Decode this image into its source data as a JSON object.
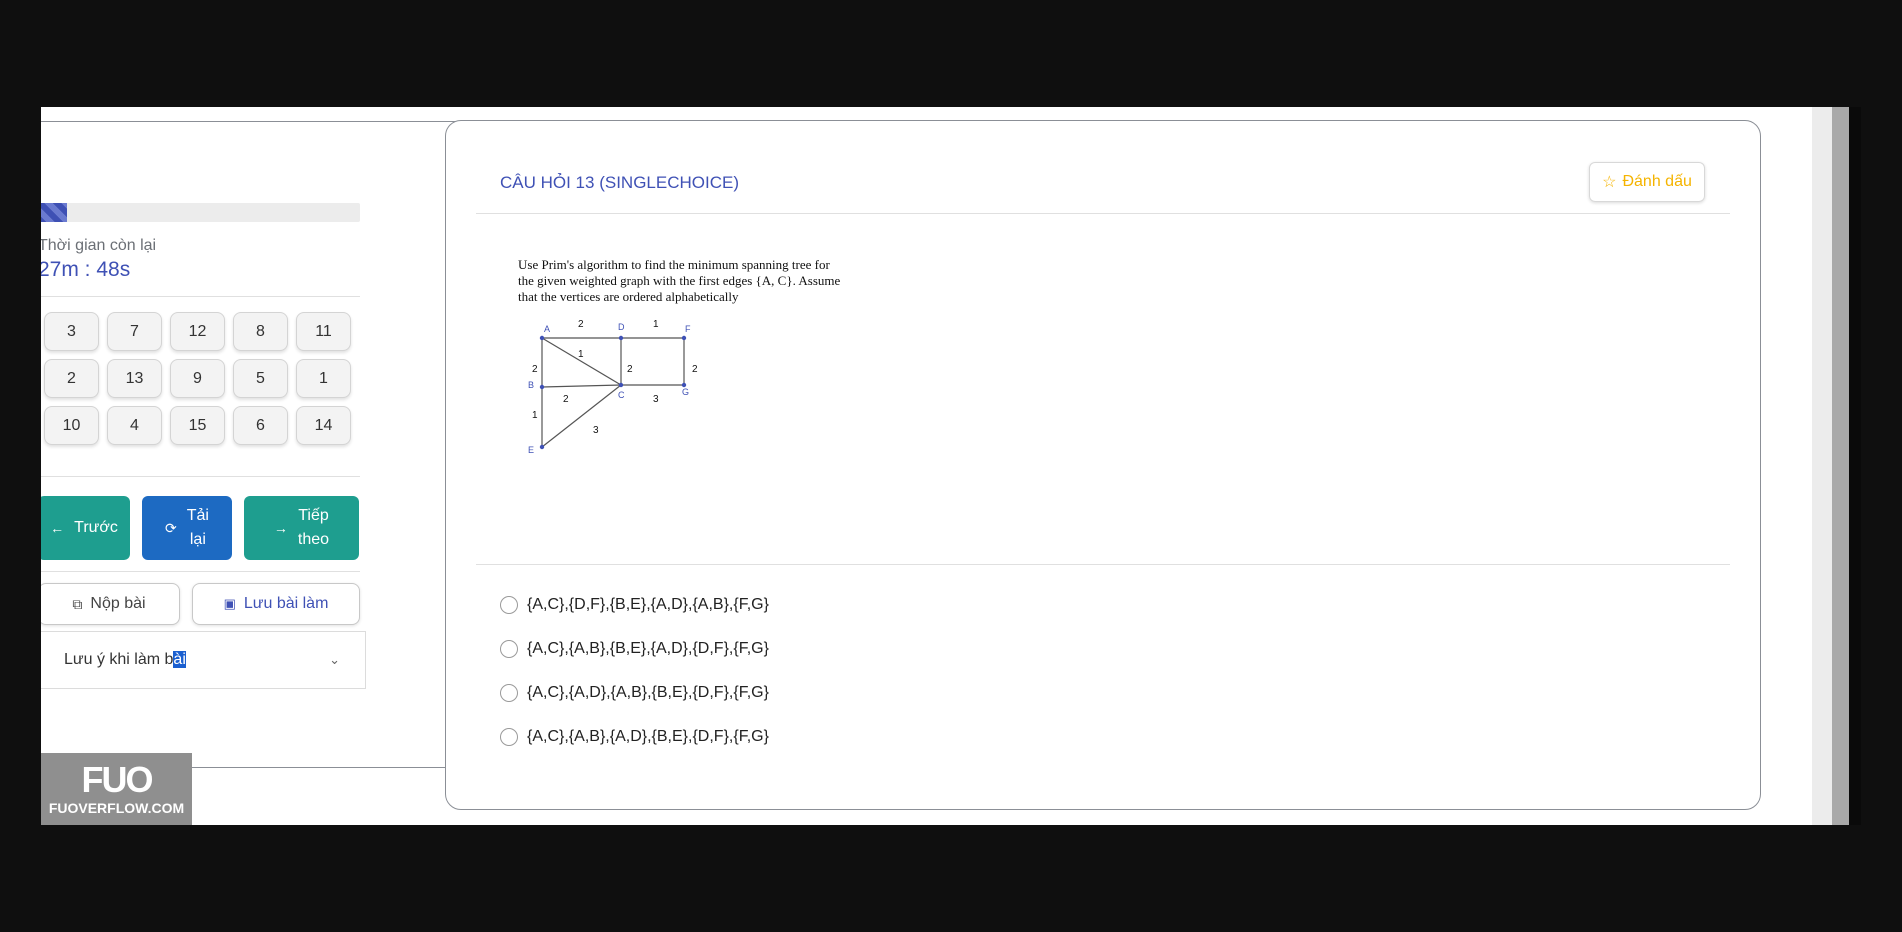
{
  "sidebar": {
    "progress_fraction": 0.09,
    "time_label": "Thời gian còn lại",
    "time_value": "27m : 48s",
    "question_numbers": [
      "3",
      "7",
      "12",
      "8",
      "11",
      "2",
      "13",
      "9",
      "5",
      "1",
      "10",
      "4",
      "15",
      "6",
      "14"
    ],
    "prev_label": "Trước",
    "reload_label_1": "Tải",
    "reload_label_2": "lại",
    "next_label_1": "Tiếp",
    "next_label_2": "theo",
    "submit_label": "Nộp bài",
    "save_label": "Lưu bài làm",
    "note_label_a": "Lưu ý khi làm b",
    "note_label_b": "ài",
    "logo_mark": "FUO",
    "logo_site": "FUOVERFLOW.COM"
  },
  "question": {
    "title": "CÂU HỎI 13 (SINGLECHOICE)",
    "mark_label": "Đánh dấu",
    "text_line1": "Use Prim's algorithm to find the minimum spanning tree for",
    "text_line2": "the given weighted graph with the first edges {A, C}. Assume",
    "text_line3": "that the vertices are ordered alphabetically",
    "graph": {
      "vertices": [
        "A",
        "B",
        "C",
        "D",
        "E",
        "F",
        "G"
      ],
      "edges": [
        {
          "from": "A",
          "to": "D",
          "w": "2"
        },
        {
          "from": "D",
          "to": "F",
          "w": "1"
        },
        {
          "from": "A",
          "to": "C",
          "w": "1"
        },
        {
          "from": "A",
          "to": "B",
          "w": "2"
        },
        {
          "from": "D",
          "to": "C",
          "w": "2"
        },
        {
          "from": "F",
          "to": "G",
          "w": "2"
        },
        {
          "from": "B",
          "to": "C",
          "w": "2"
        },
        {
          "from": "C",
          "to": "G",
          "w": "3"
        },
        {
          "from": "B",
          "to": "E",
          "w": "1"
        },
        {
          "from": "E",
          "to": "C",
          "w": "3"
        }
      ]
    },
    "options": [
      "{A,C},{D,F},{B,E},{A,D},{A,B},{F,G}",
      "{A,C},{A,B},{B,E},{A,D},{D,F},{F,G}",
      "{A,C},{A,D},{A,B},{B,E},{D,F},{F,G}",
      "{A,C},{A,B},{A,D},{B,E},{D,F},{F,G}"
    ]
  },
  "colors": {
    "accent": "#3f51b5",
    "teal": "#1e9e8f",
    "blue": "#1d6ac2",
    "mark": "#f5b400",
    "vertex": "#3f51b5"
  }
}
